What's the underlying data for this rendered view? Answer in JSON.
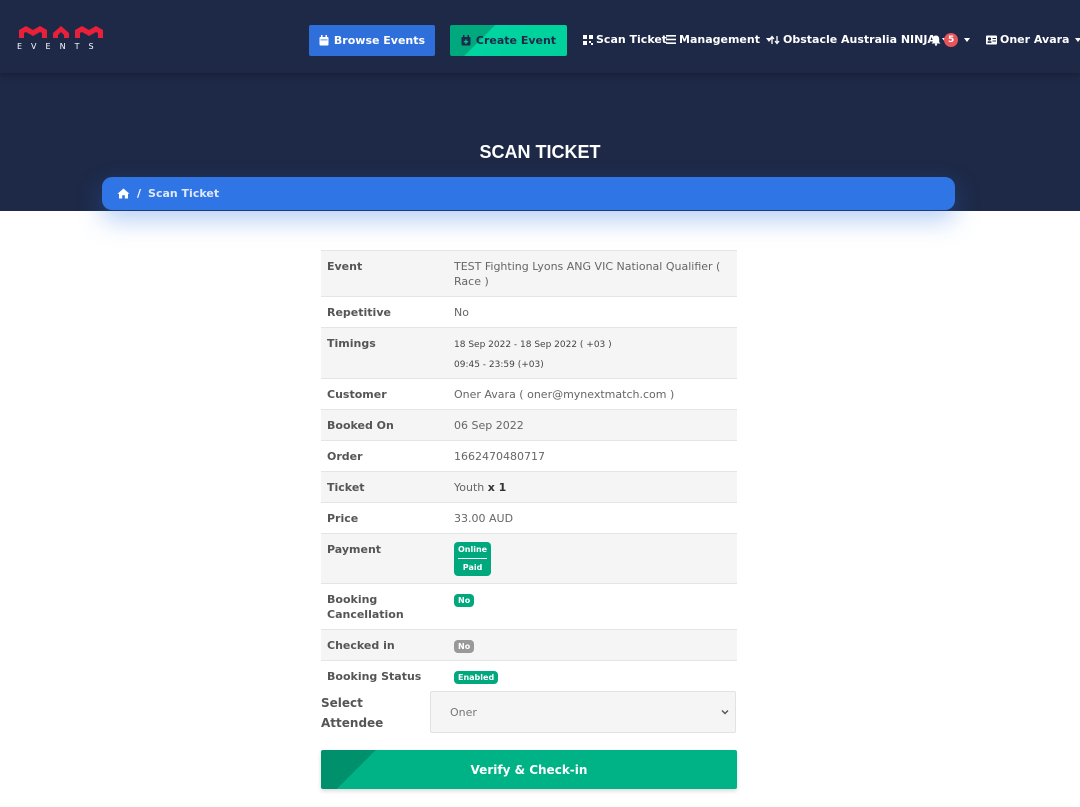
{
  "colors": {
    "nav_bg": "#1e2947",
    "primary": "#2f6fdc",
    "success": "#00a87d",
    "danger": "#e8545a"
  },
  "brand": {
    "logo_letters": "MAM",
    "logo_sub": "EVENTS"
  },
  "nav": {
    "browse_events": "Browse Events",
    "create_event": "Create Event",
    "scan_ticket": "Scan Ticket",
    "management": "Management",
    "organisation": "Obstacle Australia NINJA",
    "notifications_count": "5",
    "user": "Oner Avara"
  },
  "page": {
    "title": "SCAN TICKET",
    "breadcrumb_current": "Scan Ticket"
  },
  "details": {
    "event_label": "Event",
    "event_value": "TEST Fighting Lyons ANG VIC National Qualifier ( Race )",
    "repetitive_label": "Repetitive",
    "repetitive_value": "No",
    "timings_label": "Timings",
    "timings_dates": "18 Sep 2022 - 18 Sep 2022 ( +03 )",
    "timings_hours": "09:45 - 23:59 (+03)",
    "customer_label": "Customer",
    "customer_value": "Oner Avara ( oner@mynextmatch.com )",
    "booked_on_label": "Booked On",
    "booked_on_value": "06 Sep 2022",
    "order_label": "Order",
    "order_value": "1662470480717",
    "ticket_label": "Ticket",
    "ticket_name": "Youth",
    "ticket_qty": "x 1",
    "price_label": "Price",
    "price_value": "33.00 AUD",
    "payment_label": "Payment",
    "payment_method": "Online",
    "payment_status": "Paid",
    "cancellation_label": "Booking Cancellation",
    "cancellation_value": "No",
    "checked_in_label": "Checked in",
    "checked_in_value": "No",
    "booking_status_label": "Booking Status",
    "booking_status_value": "Enabled"
  },
  "attendee": {
    "label": "Select Attendee",
    "selected": "Oner"
  },
  "actions": {
    "verify_checkin": "Verify & Check-in"
  }
}
